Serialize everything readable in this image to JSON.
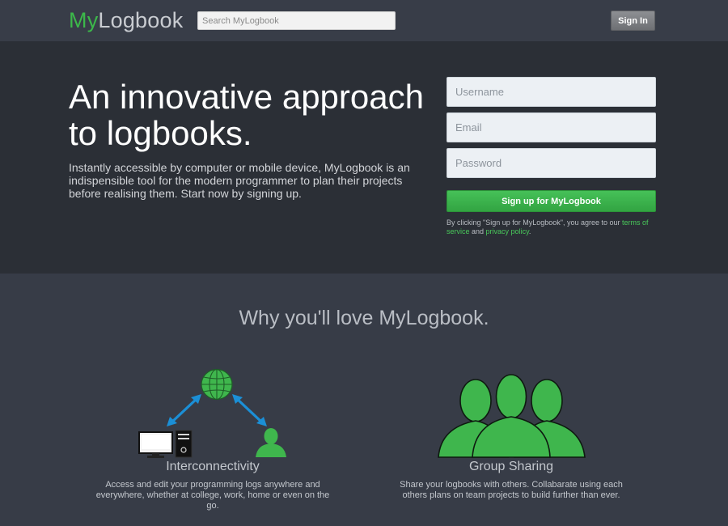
{
  "header": {
    "logo_my": "My",
    "logo_rest": "Logbook",
    "search_placeholder": "Search MyLogbook",
    "signin_label": "Sign In"
  },
  "hero": {
    "title": "An innovative approach to logbooks.",
    "description": "Instantly accessible by computer or mobile device, MyLogbook is an indispensible tool for the modern programmer to plan their projects before realising them. Start now by signing up.",
    "form": {
      "username_placeholder": "Username",
      "email_placeholder": "Email",
      "password_placeholder": "Password",
      "signup_label": "Sign up for MyLogbook",
      "legal_prefix": "By clicking \"Sign up for MyLogbook\", you agree to our ",
      "terms_link": "terms of service",
      "legal_and": " and ",
      "privacy_link": "privacy policy",
      "legal_suffix": "."
    }
  },
  "features": {
    "heading": "Why you'll love MyLogbook.",
    "items": [
      {
        "title": "Interconnectivity",
        "description": "Access and edit your programming logs anywhere and everywhere, whether at college, work, home or even on the go.",
        "icons": [
          "globe-icon",
          "monitor-icon",
          "computer-tower-icon",
          "person-icon",
          "double-arrow-icon"
        ]
      },
      {
        "title": "Group Sharing",
        "description": "Share your logbooks with others. Collabarate using each others plans on team projects to build further than ever.",
        "icons": [
          "group-people-icon"
        ]
      }
    ]
  },
  "colors": {
    "brand_green": "#3cb84a",
    "header_bg": "#383d48",
    "hero_bg": "#2b2f36",
    "body_bg": "#373c47",
    "arrow_blue": "#1b8fd6"
  }
}
